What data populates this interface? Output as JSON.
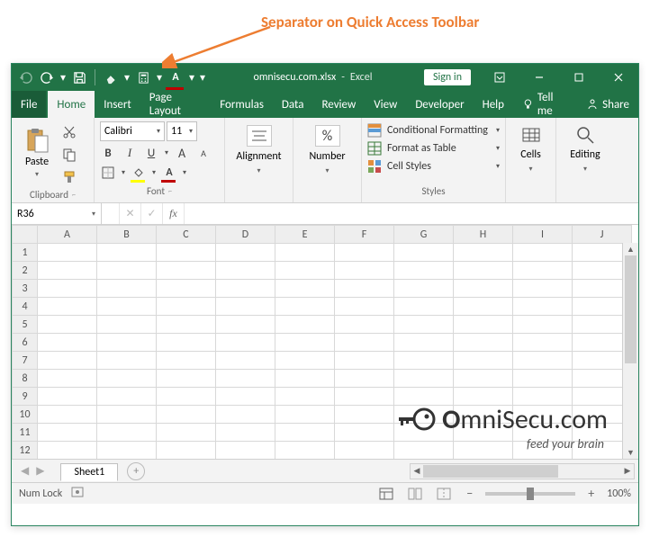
{
  "annotation": {
    "text": "Separator on Quick Access Toolbar"
  },
  "title": {
    "filename": "omnisecu.com.xlsx",
    "separator": "-",
    "app": "Excel",
    "sign_in": "Sign in"
  },
  "tabs": {
    "file": "File",
    "items": [
      "Home",
      "Insert",
      "Page Layout",
      "Formulas",
      "Data",
      "Review",
      "View",
      "Developer",
      "Help"
    ],
    "active_index": 0,
    "tell_me": "Tell me",
    "share": "Share"
  },
  "ribbon": {
    "clipboard": {
      "label": "Clipboard",
      "paste": "Paste"
    },
    "font": {
      "label": "Font",
      "name": "Calibri",
      "size": "11",
      "bold": "B",
      "italic": "I",
      "underline": "U",
      "bigA": "A",
      "smallA": "A"
    },
    "alignment": {
      "label": "Alignment"
    },
    "number": {
      "label": "Number",
      "symbol": "%"
    },
    "styles": {
      "label": "Styles",
      "cond": "Conditional Formatting",
      "table": "Format as Table",
      "cell": "Cell Styles"
    },
    "cells": {
      "label": "Cells"
    },
    "editing": {
      "label": "Editing"
    }
  },
  "formula_bar": {
    "name_box": "R36",
    "fx": "fx"
  },
  "grid": {
    "cols": [
      "A",
      "B",
      "C",
      "D",
      "E",
      "F",
      "G",
      "H",
      "I",
      "J"
    ],
    "rows": [
      "1",
      "2",
      "3",
      "4",
      "5",
      "6",
      "7",
      "8",
      "9",
      "10",
      "11",
      "12"
    ]
  },
  "sheet": {
    "tab": "Sheet1"
  },
  "status": {
    "numlock": "Num Lock",
    "zoom": "100%"
  },
  "watermark": {
    "prefix": "O",
    "mid": "mniSecu",
    "suffix": ".com",
    "tagline": "feed your brain"
  }
}
